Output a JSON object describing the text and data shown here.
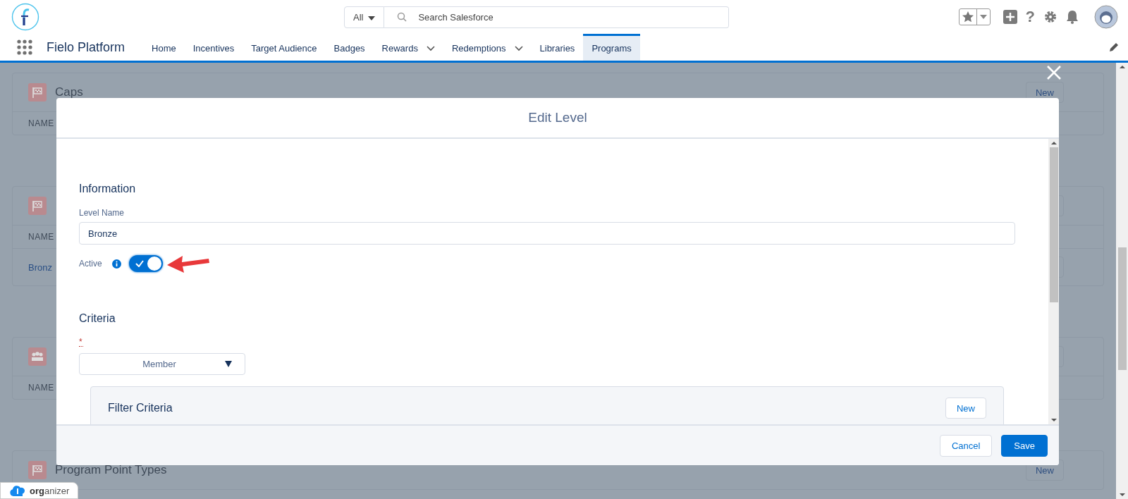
{
  "header": {
    "search": {
      "scope": "All",
      "placeholder": "Search Salesforce"
    },
    "help": "?"
  },
  "nav": {
    "app_name": "Fielo Platform",
    "tabs": [
      {
        "label": "Home",
        "selected": false,
        "has_menu": false
      },
      {
        "label": "Incentives",
        "selected": false,
        "has_menu": false
      },
      {
        "label": "Target Audience",
        "selected": false,
        "has_menu": false
      },
      {
        "label": "Badges",
        "selected": false,
        "has_menu": false
      },
      {
        "label": "Rewards",
        "selected": false,
        "has_menu": true
      },
      {
        "label": "Redemptions",
        "selected": false,
        "has_menu": true
      },
      {
        "label": "Libraries",
        "selected": false,
        "has_menu": false
      },
      {
        "label": "Programs",
        "selected": true,
        "has_menu": false
      }
    ]
  },
  "background": {
    "cards": [
      {
        "kind": "standard",
        "title": "Caps",
        "action": {
          "kind": "button",
          "label": "New"
        },
        "column": "NAME"
      },
      {
        "kind": "standard",
        "action": {
          "kind": "menu"
        },
        "column": "NAME",
        "rows": [
          {
            "cell": "Bronz"
          }
        ]
      },
      {
        "kind": "group",
        "action": {
          "kind": "menu"
        },
        "column": "NAME"
      },
      {
        "kind": "standard",
        "title": "Program Point Types",
        "action": {
          "kind": "button",
          "label": "New"
        }
      }
    ]
  },
  "modal": {
    "title": "Edit Level",
    "sections": [
      {
        "kind": "information",
        "title": "Information",
        "field_label": "Level Name",
        "value": "Bronze",
        "toggle_label": "Active",
        "on": true
      },
      {
        "kind": "criteria",
        "title": "Criteria",
        "required_mark": "*",
        "select_value": "Member",
        "panel_title": "Filter Criteria",
        "panel_button": "New"
      }
    ],
    "buttons": [
      {
        "label": "Cancel",
        "kind": "neutral"
      },
      {
        "label": "Save",
        "kind": "brand"
      }
    ]
  },
  "organizer": {
    "label": "**org**anizer"
  }
}
